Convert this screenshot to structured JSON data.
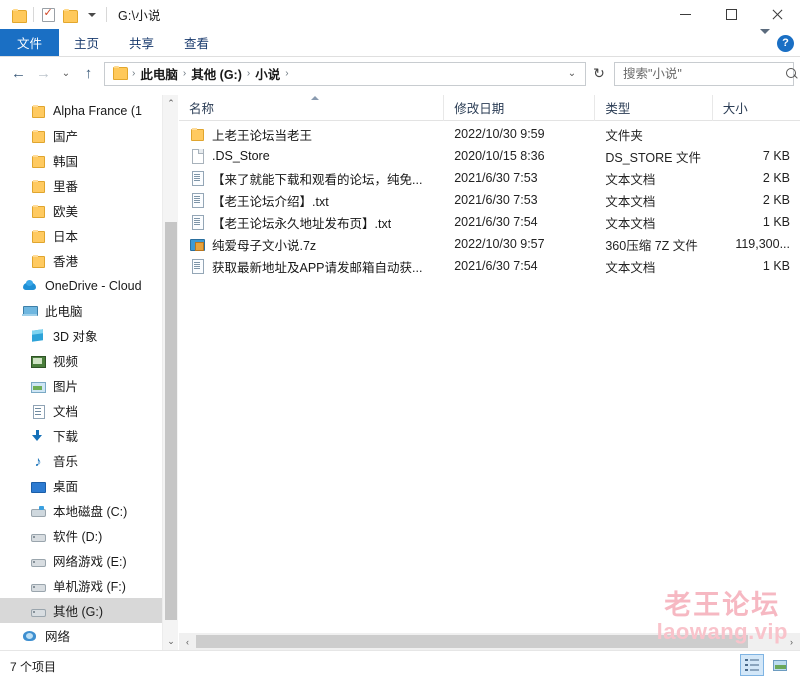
{
  "titlebar": {
    "path_title": "G:\\小说",
    "qat": [
      {
        "name": "folder-icon",
        "label": ""
      },
      {
        "name": "properties-icon",
        "label": ""
      },
      {
        "name": "new-folder-icon",
        "label": ""
      },
      {
        "name": "chevron-down-icon",
        "label": ""
      }
    ],
    "minimize": "–",
    "maximize": "□",
    "close": "✕"
  },
  "ribbon": {
    "tabs": [
      {
        "label": "文件",
        "active_file": true
      },
      {
        "label": "主页",
        "active_file": false
      },
      {
        "label": "共享",
        "active_file": false
      },
      {
        "label": "查看",
        "active_file": false
      }
    ],
    "help_label": "?"
  },
  "addressbar": {
    "back": "←",
    "forward": "→",
    "recent": "⌄",
    "up": "↑",
    "crumbs": [
      "此电脑",
      "其他 (G:)",
      "小说"
    ],
    "crumb_sep": "›",
    "dropdown": "⌄",
    "refresh": "↻"
  },
  "search": {
    "placeholder": "搜索\"小说\"",
    "value": ""
  },
  "sidebar": {
    "items": [
      {
        "label": "Alpha France  (1",
        "icon": "folder",
        "indent": 2,
        "selected": false
      },
      {
        "label": "国产",
        "icon": "folder",
        "indent": 2,
        "selected": false
      },
      {
        "label": "韩国",
        "icon": "folder",
        "indent": 2,
        "selected": false
      },
      {
        "label": "里番",
        "icon": "folder",
        "indent": 2,
        "selected": false
      },
      {
        "label": "欧美",
        "icon": "folder",
        "indent": 2,
        "selected": false
      },
      {
        "label": "日本",
        "icon": "folder",
        "indent": 2,
        "selected": false
      },
      {
        "label": "香港",
        "icon": "folder",
        "indent": 2,
        "selected": false
      },
      {
        "label": "OneDrive - Cloud",
        "icon": "cloud",
        "indent": 1,
        "selected": false
      },
      {
        "label": "此电脑",
        "icon": "pc",
        "indent": 1,
        "selected": false
      },
      {
        "label": "3D 对象",
        "icon": "cube",
        "indent": 2,
        "selected": false
      },
      {
        "label": "视频",
        "icon": "video",
        "indent": 2,
        "selected": false
      },
      {
        "label": "图片",
        "icon": "picture",
        "indent": 2,
        "selected": false
      },
      {
        "label": "文档",
        "icon": "doc",
        "indent": 2,
        "selected": false
      },
      {
        "label": "下载",
        "icon": "download",
        "indent": 2,
        "selected": false
      },
      {
        "label": "音乐",
        "icon": "music",
        "indent": 2,
        "selected": false
      },
      {
        "label": "桌面",
        "icon": "desktop",
        "indent": 2,
        "selected": false
      },
      {
        "label": "本地磁盘 (C:)",
        "icon": "drive sys",
        "indent": 2,
        "selected": false
      },
      {
        "label": "软件 (D:)",
        "icon": "drive",
        "indent": 2,
        "selected": false
      },
      {
        "label": "网络游戏 (E:)",
        "icon": "drive",
        "indent": 2,
        "selected": false
      },
      {
        "label": "单机游戏 (F:)",
        "icon": "drive",
        "indent": 2,
        "selected": false
      },
      {
        "label": "其他 (G:)",
        "icon": "drive",
        "indent": 2,
        "selected": true
      },
      {
        "label": "网络",
        "icon": "network",
        "indent": 1,
        "selected": false
      }
    ],
    "scroll_up": "⌃",
    "scroll_down": "⌄"
  },
  "filelist": {
    "columns": [
      {
        "label": "名称",
        "sorted": true
      },
      {
        "label": "修改日期",
        "sorted": false
      },
      {
        "label": "类型",
        "sorted": false
      },
      {
        "label": "大小",
        "sorted": false
      }
    ],
    "rows": [
      {
        "name": "上老王论坛当老王",
        "icon": "folder",
        "date": "2022/10/30 9:59",
        "type": "文件夹",
        "size": ""
      },
      {
        "name": ".DS_Store",
        "icon": "blank",
        "date": "2020/10/15 8:36",
        "type": "DS_STORE 文件",
        "size": "7 KB"
      },
      {
        "name": "【来了就能下载和观看的论坛，纯免...",
        "icon": "text",
        "date": "2021/6/30 7:53",
        "type": "文本文档",
        "size": "2 KB"
      },
      {
        "name": "【老王论坛介绍】.txt",
        "icon": "text",
        "date": "2021/6/30 7:53",
        "type": "文本文档",
        "size": "2 KB"
      },
      {
        "name": "【老王论坛永久地址发布页】.txt",
        "icon": "text",
        "date": "2021/6/30 7:54",
        "type": "文本文档",
        "size": "1 KB"
      },
      {
        "name": "纯爱母子文小说.7z",
        "icon": "archive",
        "date": "2022/10/30 9:57",
        "type": "360压缩 7Z 文件",
        "size": "119,300..."
      },
      {
        "name": "获取最新地址及APP请发邮箱自动获...",
        "icon": "text",
        "date": "2021/6/30 7:54",
        "type": "文本文档",
        "size": "1 KB"
      }
    ],
    "hscroll_left": "‹",
    "hscroll_right": "›"
  },
  "statusbar": {
    "item_count": "7 个项目",
    "view_details": "详细信息",
    "view_large_icons": "大图标"
  },
  "watermark": {
    "line1": "老王论坛",
    "line2": "laowang.vip",
    "color": "#f6b8c2"
  }
}
